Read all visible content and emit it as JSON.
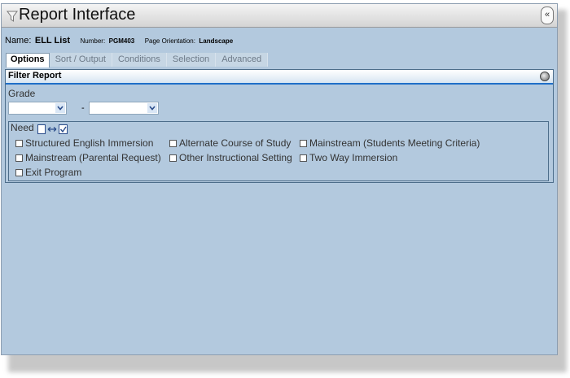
{
  "window": {
    "title": "Report Interface",
    "collapse_glyph": "«"
  },
  "info": {
    "name_label": "Name:",
    "name_value": "ELL List",
    "number_label": "Number:",
    "number_value": "PGM403",
    "orientation_label": "Page Orientation:",
    "orientation_value": "Landscape"
  },
  "tabs": [
    {
      "label": "Options",
      "active": true
    },
    {
      "label": "Sort / Output",
      "active": false
    },
    {
      "label": "Conditions",
      "active": false
    },
    {
      "label": "Selection",
      "active": false
    },
    {
      "label": "Advanced",
      "active": false
    }
  ],
  "filter": {
    "title": "Filter Report",
    "grade_label": "Grade",
    "grade_from_value": "",
    "grade_to_value": "",
    "range_separator": "-",
    "need_label": "Need",
    "need_options": [
      {
        "label": "Structured English Immersion",
        "checked": false
      },
      {
        "label": "Alternate Course of Study",
        "checked": false
      },
      {
        "label": "Mainstream (Students Meeting Criteria)",
        "checked": false
      },
      {
        "label": "Mainstream (Parental Request)",
        "checked": false
      },
      {
        "label": "Other Instructional Setting",
        "checked": false
      },
      {
        "label": "Two Way Immersion",
        "checked": false
      },
      {
        "label": "Exit Program",
        "checked": false
      }
    ]
  },
  "icons": {
    "filter": "funnel-icon",
    "collapse": "double-chevron-left-icon",
    "panel_toggle": "collapse-circle-icon",
    "select_all": "select-all-icon",
    "dropdown": "chevron-down-icon"
  },
  "colors": {
    "window_bg": "#b3c9de",
    "panel_header_border": "#1f6fc8",
    "active_tab_bg": "#ffffff"
  }
}
